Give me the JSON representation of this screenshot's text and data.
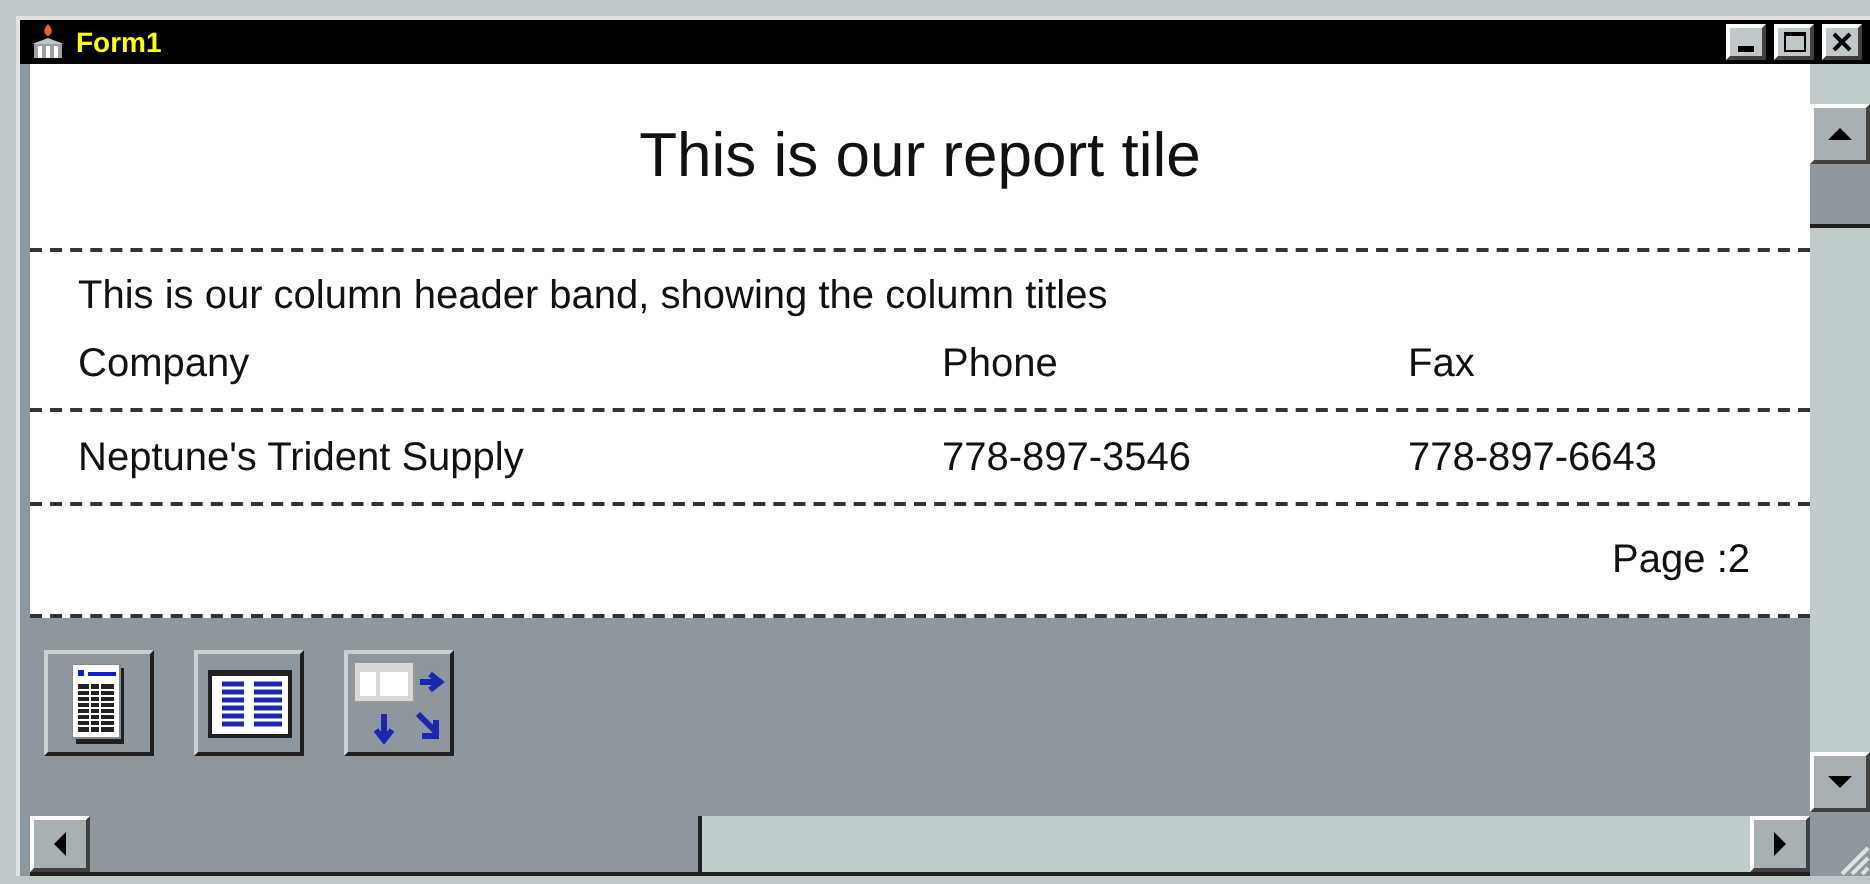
{
  "window": {
    "title": "Form1"
  },
  "report": {
    "title": "This is our report tile",
    "header_note": "This is our column header band, showing the column titles",
    "columns": [
      "Company",
      "Phone",
      "Fax"
    ],
    "rows": [
      [
        "Neptune's Trident Supply",
        "778-897-3546",
        "778-897-6643"
      ]
    ],
    "footer": "Page :2"
  }
}
